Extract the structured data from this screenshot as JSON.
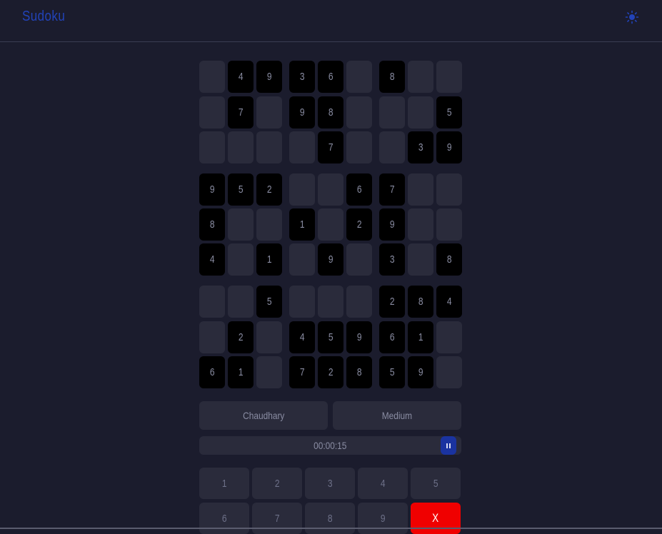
{
  "header": {
    "logo": "Sudoku",
    "theme_icon": "sun-icon",
    "accent_color": "#2243b8"
  },
  "board": {
    "rows": [
      [
        "",
        "4",
        "9",
        "3",
        "6",
        "",
        "8",
        "",
        ""
      ],
      [
        "",
        "7",
        "",
        "9",
        "8",
        "",
        "",
        "",
        "5"
      ],
      [
        "",
        "",
        "",
        "",
        "7",
        "",
        "",
        "3",
        "9"
      ],
      [
        "9",
        "5",
        "2",
        "",
        "",
        "6",
        "7",
        "",
        ""
      ],
      [
        "8",
        "",
        "",
        "1",
        "",
        "2",
        "9",
        "",
        ""
      ],
      [
        "4",
        "",
        "1",
        "",
        "9",
        "",
        "3",
        "",
        "8"
      ],
      [
        "",
        "",
        "5",
        "",
        "",
        "",
        "2",
        "8",
        "4"
      ],
      [
        "",
        "2",
        "",
        "4",
        "5",
        "9",
        "6",
        "1",
        ""
      ],
      [
        "6",
        "1",
        "",
        "7",
        "2",
        "8",
        "5",
        "9",
        ""
      ]
    ]
  },
  "info": {
    "player": "Chaudhary",
    "difficulty": "Medium"
  },
  "timer": {
    "value": "00:00:15",
    "pause_icon": "pause-icon"
  },
  "keypad": {
    "keys": [
      "1",
      "2",
      "3",
      "4",
      "5",
      "6",
      "7",
      "8",
      "9",
      "X"
    ],
    "erase_color": "#f00000"
  }
}
